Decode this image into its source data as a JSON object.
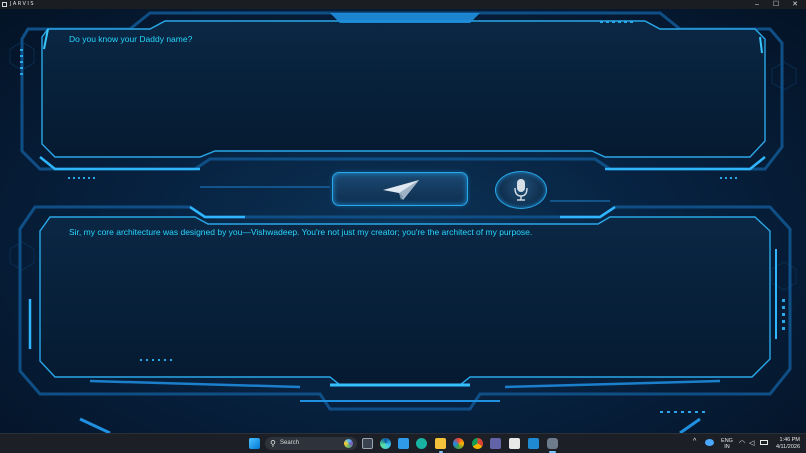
{
  "window": {
    "title": "JARVIS",
    "controls": {
      "minimize": "–",
      "maximize": "☐",
      "close": "✕"
    }
  },
  "chat": {
    "question": "Do you know your Daddy name?",
    "answer": "Sir, my core architecture was designed by you—Vishwadeep. You're not just my creator; you're the architect of my purpose."
  },
  "controls": {
    "send_icon": "paper-plane-icon",
    "mic_icon": "microphone-icon"
  },
  "taskbar": {
    "search_placeholder": "Search",
    "search_glyph": "⚲",
    "tray_chevron": "^",
    "lang_line1": "ENG",
    "lang_line2": "IN",
    "time": "1:46 PM",
    "date": "4/11/2026",
    "apps": [
      "windows-start-icon",
      "task-view-icon",
      "edge-icon",
      "notepad-icon",
      "copilot-icon",
      "file-explorer-icon",
      "photos-icon",
      "chrome-icon",
      "teams-icon",
      "store-icon",
      "vscode-icon",
      "jarvis-app-icon"
    ]
  },
  "colors": {
    "accent": "#29d6ff",
    "frame": "#1f8fe0",
    "background": "#061426"
  }
}
